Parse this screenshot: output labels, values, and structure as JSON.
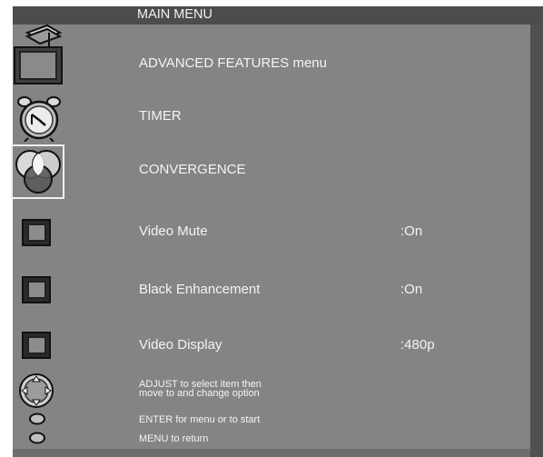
{
  "menu": {
    "title": "MAIN MENU",
    "items": [
      {
        "label": "ADVANCED FEATURES menu",
        "value": "",
        "icon": "tv-settings-icon"
      },
      {
        "label": "TIMER",
        "value": "",
        "icon": "alarm-clock-icon"
      },
      {
        "label": "CONVERGENCE",
        "value": "",
        "icon": "convergence-icon",
        "selected": true
      },
      {
        "label": "Video Mute",
        "value": ":On",
        "icon": "square-box-icon"
      },
      {
        "label": "Black Enhancement",
        "value": ":On",
        "icon": "square-box-icon"
      },
      {
        "label": "Video Display",
        "value": ":480p",
        "icon": "square-box-icon"
      }
    ]
  },
  "help": {
    "adjust_line1": "ADJUST to select item then",
    "adjust_line2": "move to and change option",
    "enter_text": "ENTER for menu or to start",
    "menu_text": "MENU to return"
  },
  "colors": {
    "panel": "#848484",
    "titlebar": "#4c4c4c",
    "text": "#f4f4f4"
  }
}
